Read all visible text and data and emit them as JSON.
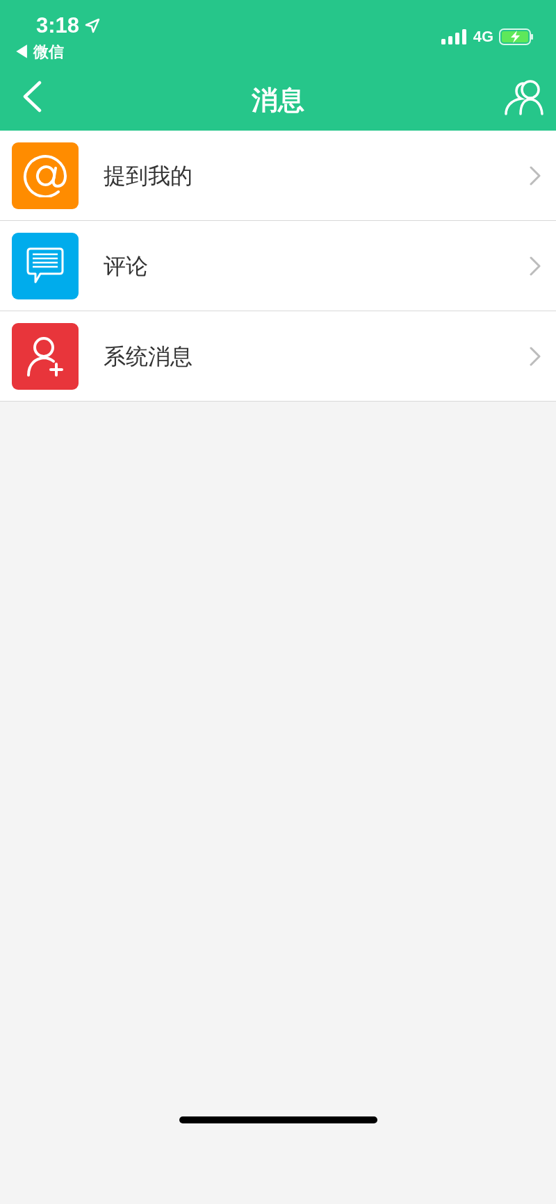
{
  "status_bar": {
    "time": "3:18",
    "back_app": "◀ 微信",
    "network": "4G"
  },
  "nav_bar": {
    "title": "消息"
  },
  "items": [
    {
      "kind": "mention",
      "label": "提到我的",
      "color": "#ff8c00"
    },
    {
      "kind": "comment",
      "label": "评论",
      "color": "#00acec"
    },
    {
      "kind": "system",
      "label": "系统消息",
      "color": "#e8353b"
    }
  ]
}
